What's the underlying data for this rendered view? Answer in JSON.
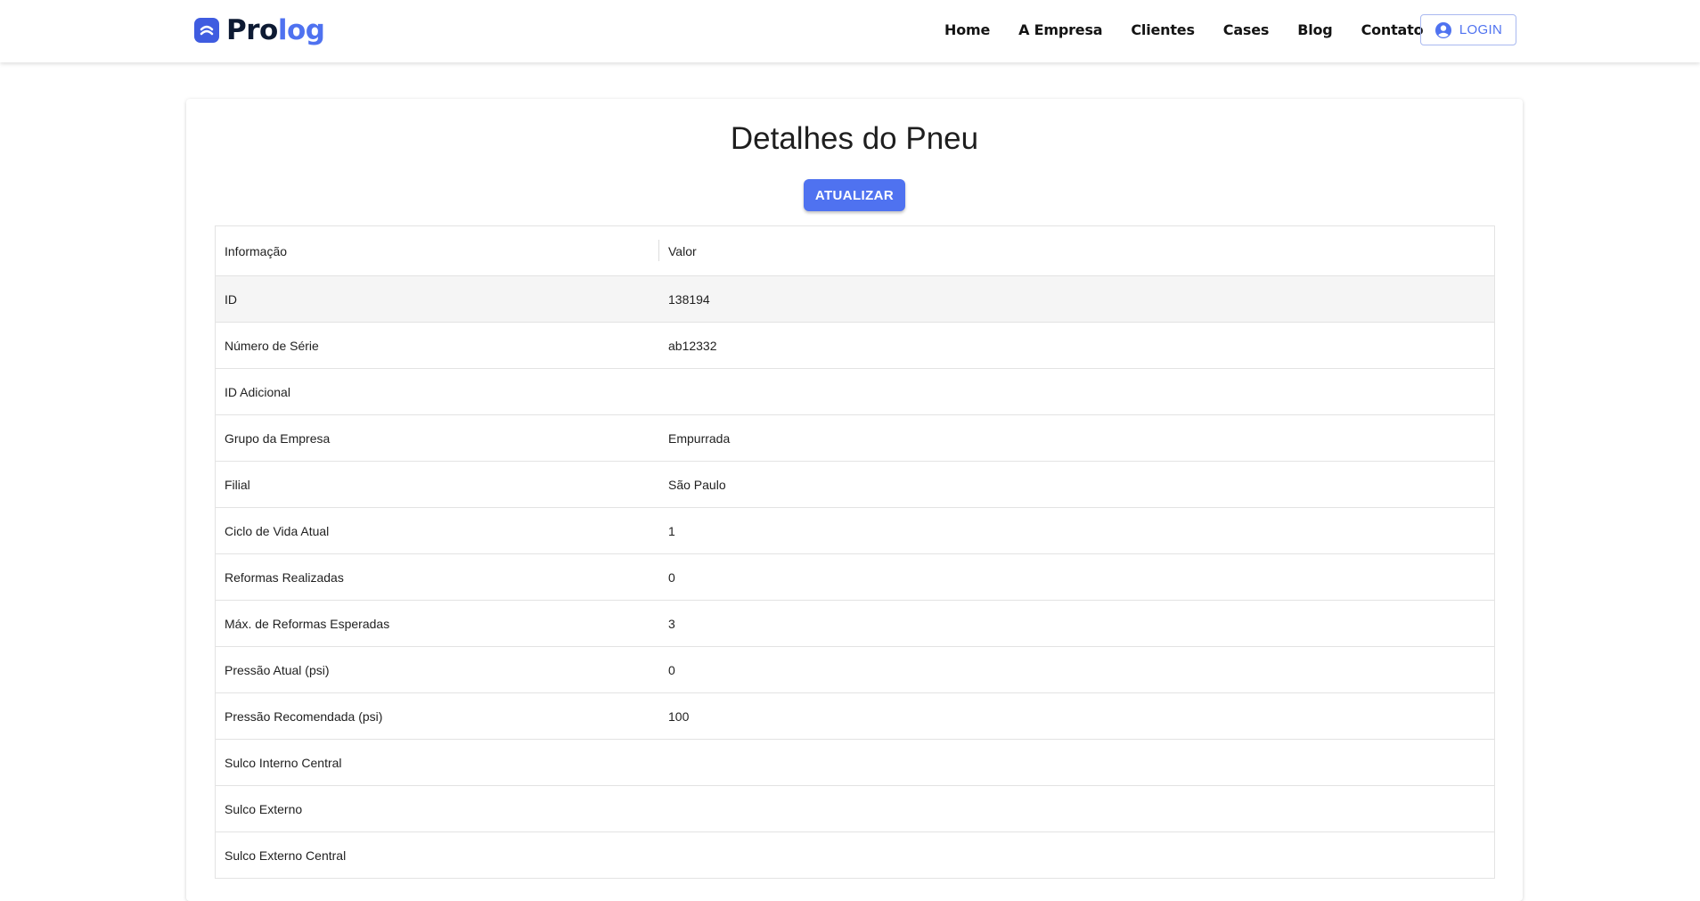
{
  "brand": {
    "name_part1": "Pro",
    "name_part2": "log",
    "primary_color": "#4f72f0",
    "logo_icon": "prolog-logo-icon"
  },
  "nav": {
    "links": [
      "Home",
      "A Empresa",
      "Clientes",
      "Cases",
      "Blog",
      "Contato"
    ],
    "login_label": "LOGIN",
    "login_icon": "account-circle-icon"
  },
  "page": {
    "title": "Detalhes do Pneu",
    "update_label": "ATUALIZAR"
  },
  "table": {
    "headers": [
      "Informação",
      "Valor"
    ],
    "rows": [
      {
        "label": "ID",
        "value": "138194"
      },
      {
        "label": "Número de Série",
        "value": "ab12332"
      },
      {
        "label": "ID Adicional",
        "value": ""
      },
      {
        "label": "Grupo da Empresa",
        "value": "Empurrada"
      },
      {
        "label": "Filial",
        "value": "São Paulo"
      },
      {
        "label": "Ciclo de Vida Atual",
        "value": "1"
      },
      {
        "label": "Reformas Realizadas",
        "value": "0"
      },
      {
        "label": "Máx. de Reformas Esperadas",
        "value": "3"
      },
      {
        "label": "Pressão Atual (psi)",
        "value": "0"
      },
      {
        "label": "Pressão Recomendada (psi)",
        "value": "100"
      },
      {
        "label": "Sulco Interno Central",
        "value": ""
      },
      {
        "label": "Sulco Externo",
        "value": ""
      },
      {
        "label": "Sulco Externo Central",
        "value": ""
      }
    ]
  }
}
